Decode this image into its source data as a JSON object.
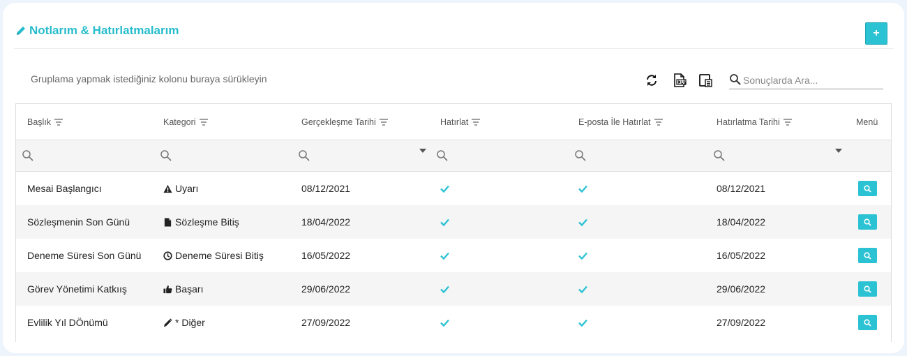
{
  "header": {
    "title": "Notlarım & Hatırlatmalarım",
    "add_label": "+"
  },
  "toolbar": {
    "group_hint": "Gruplama yapmak istediğiniz kolonu buraya sürükleyin",
    "search_placeholder": "Sonuçlarda Ara...",
    "tools": [
      "refresh-icon",
      "excel-export-icon",
      "column-chooser-icon"
    ]
  },
  "columns": [
    {
      "label": "Başlık"
    },
    {
      "label": "Kategori"
    },
    {
      "label": "Gerçekleşme Tarihi"
    },
    {
      "label": "Hatırlat"
    },
    {
      "label": "E-posta İle Hatırlat"
    },
    {
      "label": "Hatırlatma Tarihi"
    },
    {
      "label": "Menü"
    }
  ],
  "rows": [
    {
      "title": "Mesai Başlangıcı",
      "category_icon": "warning-icon",
      "category": "Uyarı",
      "date": "08/12/2021",
      "remind": true,
      "email_remind": true,
      "remind_date": "08/12/2021"
    },
    {
      "title": "Sözleşmenin Son Günü",
      "category_icon": "file-icon",
      "category": "Sözleşme Bitiş",
      "date": "18/04/2022",
      "remind": true,
      "email_remind": true,
      "remind_date": "18/04/2022"
    },
    {
      "title": "Deneme Süresi Son Günü",
      "category_icon": "clock-icon",
      "category": "Deneme Süresi Bitiş",
      "date": "16/05/2022",
      "remind": true,
      "email_remind": true,
      "remind_date": "16/05/2022"
    },
    {
      "title": "Görev Yönetimi Katkıış",
      "category_icon": "thumbs-up-icon",
      "category": "Başarı",
      "date": "29/06/2022",
      "remind": true,
      "email_remind": true,
      "remind_date": "29/06/2022"
    },
    {
      "title": "Evlilik Yıl DÖnümü",
      "category_icon": "pencil-icon",
      "category": "* Diğer",
      "date": "27/09/2022",
      "remind": true,
      "email_remind": true,
      "remind_date": "27/09/2022"
    }
  ],
  "colors": {
    "accent": "#2bc2d3",
    "title": "#26bccc",
    "row_alt": "#f5f5f5"
  }
}
